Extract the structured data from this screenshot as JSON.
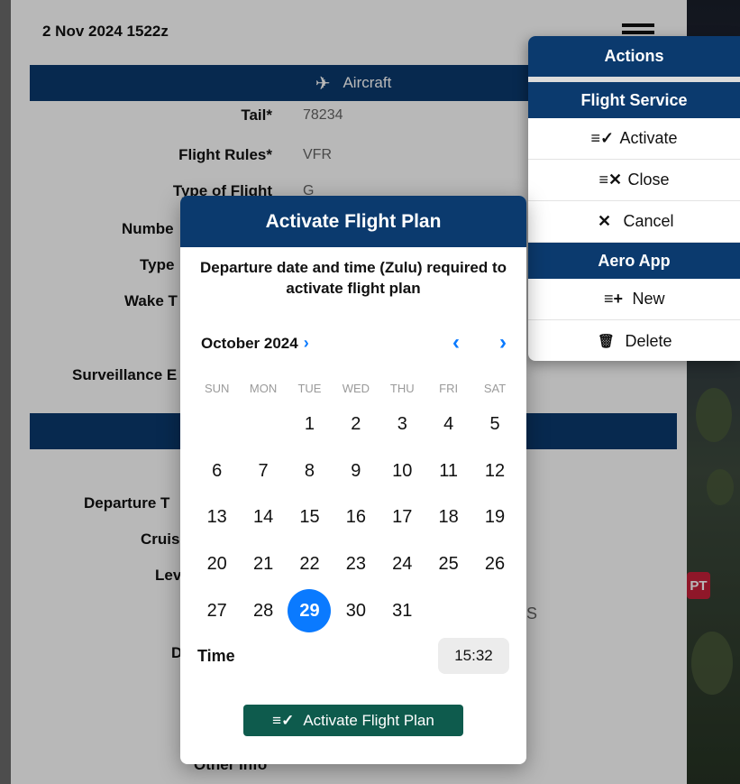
{
  "header": {
    "datetime": "2 Nov 2024 1522z"
  },
  "form": {
    "aircraft_section": "Aircraft",
    "fields": [
      {
        "label": "Tail*",
        "value": "78234"
      },
      {
        "label": "Flight Rules*",
        "value": "VFR"
      },
      {
        "label": "Type of Flight",
        "value": "G"
      },
      {
        "label": "Numbe",
        "value": ""
      },
      {
        "label": "Type",
        "value": ""
      },
      {
        "label": "Wake T",
        "value": ""
      },
      {
        "label": "Surveillance E",
        "value": ""
      },
      {
        "label": "Departure T",
        "value": ""
      },
      {
        "label": "Cruis",
        "value": ""
      },
      {
        "label": "Lev",
        "value": ""
      },
      {
        "label": "D",
        "value": ""
      }
    ],
    "partial_text_s": "S",
    "bottom_partial": "Other Info"
  },
  "map": {
    "badge_text": "PT"
  },
  "actions_menu": {
    "title": "Actions",
    "flight_service_header": "Flight Service",
    "flight_service_items": [
      {
        "label": "Activate",
        "icon": "≡✓"
      },
      {
        "label": "Close",
        "icon": "≡✕"
      },
      {
        "label": "Cancel",
        "icon": "✕"
      }
    ],
    "aero_app_header": "Aero App",
    "aero_app_items": [
      {
        "label": "New",
        "icon": "≡+"
      },
      {
        "label": "Delete",
        "icon": "🗑"
      }
    ]
  },
  "dialog": {
    "title": "Activate Flight Plan",
    "message": "Departure date and time (Zulu) required to activate flight plan",
    "month": "October 2024",
    "weekdays": [
      "SUN",
      "MON",
      "TUE",
      "WED",
      "THU",
      "FRI",
      "SAT"
    ],
    "days": [
      "",
      "",
      "1",
      "2",
      "3",
      "4",
      "5",
      "6",
      "7",
      "8",
      "9",
      "10",
      "11",
      "12",
      "13",
      "14",
      "15",
      "16",
      "17",
      "18",
      "19",
      "20",
      "21",
      "22",
      "23",
      "24",
      "25",
      "26",
      "27",
      "28",
      "29",
      "30",
      "31"
    ],
    "selected_day": "29",
    "time_label": "Time",
    "time_value": "15:32",
    "button_label": "Activate Flight Plan"
  },
  "colors": {
    "navy": "#0b3a6e",
    "accent_blue": "#0a7aff",
    "button_green": "#0e5b4d"
  }
}
